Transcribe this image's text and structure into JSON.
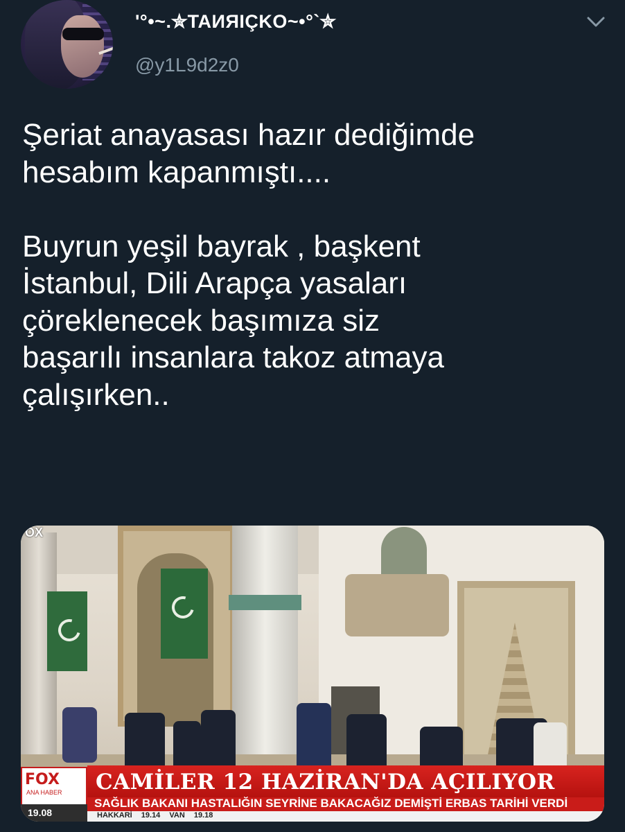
{
  "header": {
    "display_name": "'°•~.✮TAИЯIÇKO~•°`✮",
    "handle": "@y1L9d2z0",
    "avatar_icon": "profile-avatar-woman-sunglasses",
    "menu_icon": "chevron-down-icon"
  },
  "tweet": {
    "text": "Şeriat anayasası hazır dediğimde\nhesabım kapanmıştı....\n\nBuyrun yeşil bayrak , başkent\nİstanbul, Dili Arapça yasaları\nçöreklenecek başımıza siz\nbaşarılı insanlara takoz atmaya\nçalışırken.."
  },
  "media": {
    "corner_logo": "OX",
    "channel_logo": "FOX",
    "channel_sub": "ANA HABER",
    "clock": "19.08",
    "headline": "CAMİLER 12 HAZİRAN'DA AÇILIYOR",
    "subheadline": "SAĞLIK BAKANI HASTALIĞIN SEYRİNE BAKACAĞIZ DEMİŞTİ ERBAS TARİHİ VERDİ",
    "city_ticker": "HAKKARİ 19.14 VAN 19.18"
  },
  "colors": {
    "background": "#15202b",
    "text_primary": "#ffffff",
    "text_secondary": "#8899a6",
    "ticker_red": "#c91c19"
  }
}
